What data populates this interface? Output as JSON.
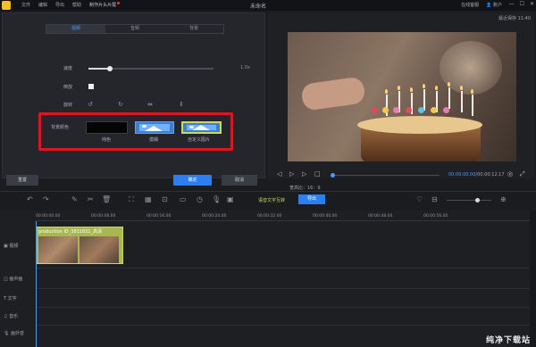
{
  "titlebar": {
    "menu": [
      "文件",
      "编辑",
      "导出",
      "帮助"
    ],
    "promo": "制作片头片尾",
    "title": "未命名",
    "buy": "在线客服",
    "account": "账户"
  },
  "editor": {
    "tabs": [
      "视频",
      "音频",
      "背景"
    ],
    "speed_label": "速度",
    "speed_value": "1.0x",
    "speed_fraction": 0.17,
    "reverse_label": "倒放",
    "rotate_label": "旋转",
    "bg_color_label": "背景颜色",
    "options": [
      "纯色",
      "模糊",
      "自定义图片"
    ],
    "reset": "重置",
    "ok": "确定",
    "cancel": "取消"
  },
  "preview": {
    "last_saved": "最近保存 11:40",
    "timecode_current": "00:00:00.00",
    "timecode_total": "/00:00:12.17",
    "ratio": "宽高比：16：9"
  },
  "toolbar": {
    "auto_subtitle": "语音文字互转",
    "export": "导出"
  },
  "timeline": {
    "ticks": [
      "00:00:00.00",
      "00:00:08.00",
      "00:00:16.00",
      "00:00:24.00",
      "00:00:32.00",
      "00:00:40.00",
      "00:00:48.00",
      "00:00:56.00"
    ],
    "tracks": [
      "视频",
      "画中画",
      "文字",
      "音乐",
      "画外音"
    ],
    "clip_name": "production ID_3831831_高清"
  },
  "watermark": "纯净下载站",
  "colors": {
    "accent": "#2b7ff2",
    "highlight": "#e0141a",
    "clip": "#a8b84f"
  }
}
